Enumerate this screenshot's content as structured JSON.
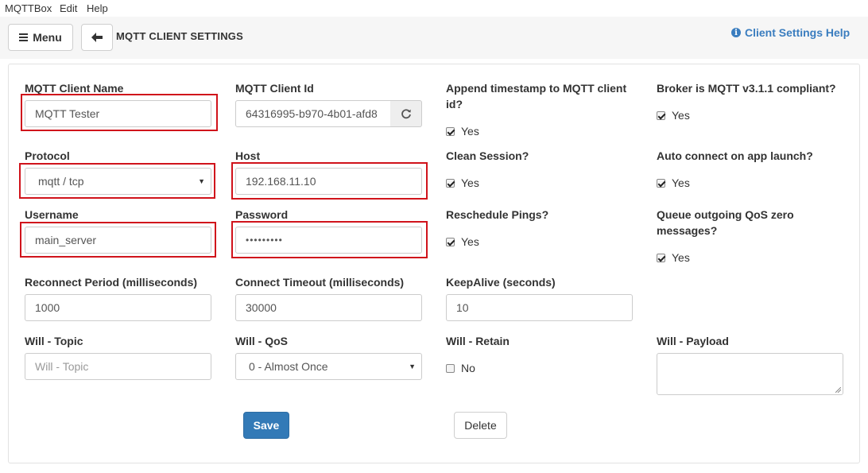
{
  "menubar": {
    "app": "MQTTBox",
    "edit": "Edit",
    "help": "Help"
  },
  "toolbar": {
    "menu_label": "Menu",
    "title": "MQTT CLIENT SETTINGS",
    "help_label": "Client Settings Help"
  },
  "form": {
    "client_name": {
      "label": "MQTT Client Name",
      "value": "MQTT Tester"
    },
    "client_id": {
      "label": "MQTT Client Id",
      "value": "64316995-b970-4b01-afd8"
    },
    "append_timestamp": {
      "label": "Append timestamp to MQTT client id?",
      "option": "Yes",
      "checked": true
    },
    "broker_compliant": {
      "label": "Broker is MQTT v3.1.1 compliant?",
      "option": "Yes",
      "checked": true
    },
    "protocol": {
      "label": "Protocol",
      "value": "mqtt / tcp"
    },
    "host": {
      "label": "Host",
      "value": "192.168.11.10"
    },
    "clean_session": {
      "label": "Clean Session?",
      "option": "Yes",
      "checked": true
    },
    "auto_connect": {
      "label": "Auto connect on app launch?",
      "option": "Yes",
      "checked": true
    },
    "username": {
      "label": "Username",
      "value": "main_server"
    },
    "password": {
      "label": "Password",
      "value": "•••••••••"
    },
    "reschedule_pings": {
      "label": "Reschedule Pings?",
      "option": "Yes",
      "checked": true
    },
    "queue_qos_zero": {
      "label": "Queue outgoing QoS zero messages?",
      "option": "Yes",
      "checked": true
    },
    "reconnect_period": {
      "label": "Reconnect Period (milliseconds)",
      "value": "1000"
    },
    "connect_timeout": {
      "label": "Connect Timeout (milliseconds)",
      "value": "30000"
    },
    "keepalive": {
      "label": "KeepAlive (seconds)",
      "value": "10"
    },
    "will_topic": {
      "label": "Will - Topic",
      "placeholder": "Will - Topic"
    },
    "will_qos": {
      "label": "Will - QoS",
      "value": "0 - Almost Once"
    },
    "will_retain": {
      "label": "Will - Retain",
      "option": "No",
      "checked": false
    },
    "will_payload": {
      "label": "Will - Payload",
      "value": ""
    }
  },
  "actions": {
    "save_label": "Save",
    "delete_label": "Delete"
  },
  "colors": {
    "accent": "#337ab7",
    "highlight": "#d0131b",
    "help_link": "#3a7dbf"
  },
  "icons": {
    "menu": "hamburger-icon",
    "back": "arrow-left-icon",
    "help": "info-circle-icon",
    "refresh": "refresh-icon",
    "select": "caret-down-icon"
  }
}
